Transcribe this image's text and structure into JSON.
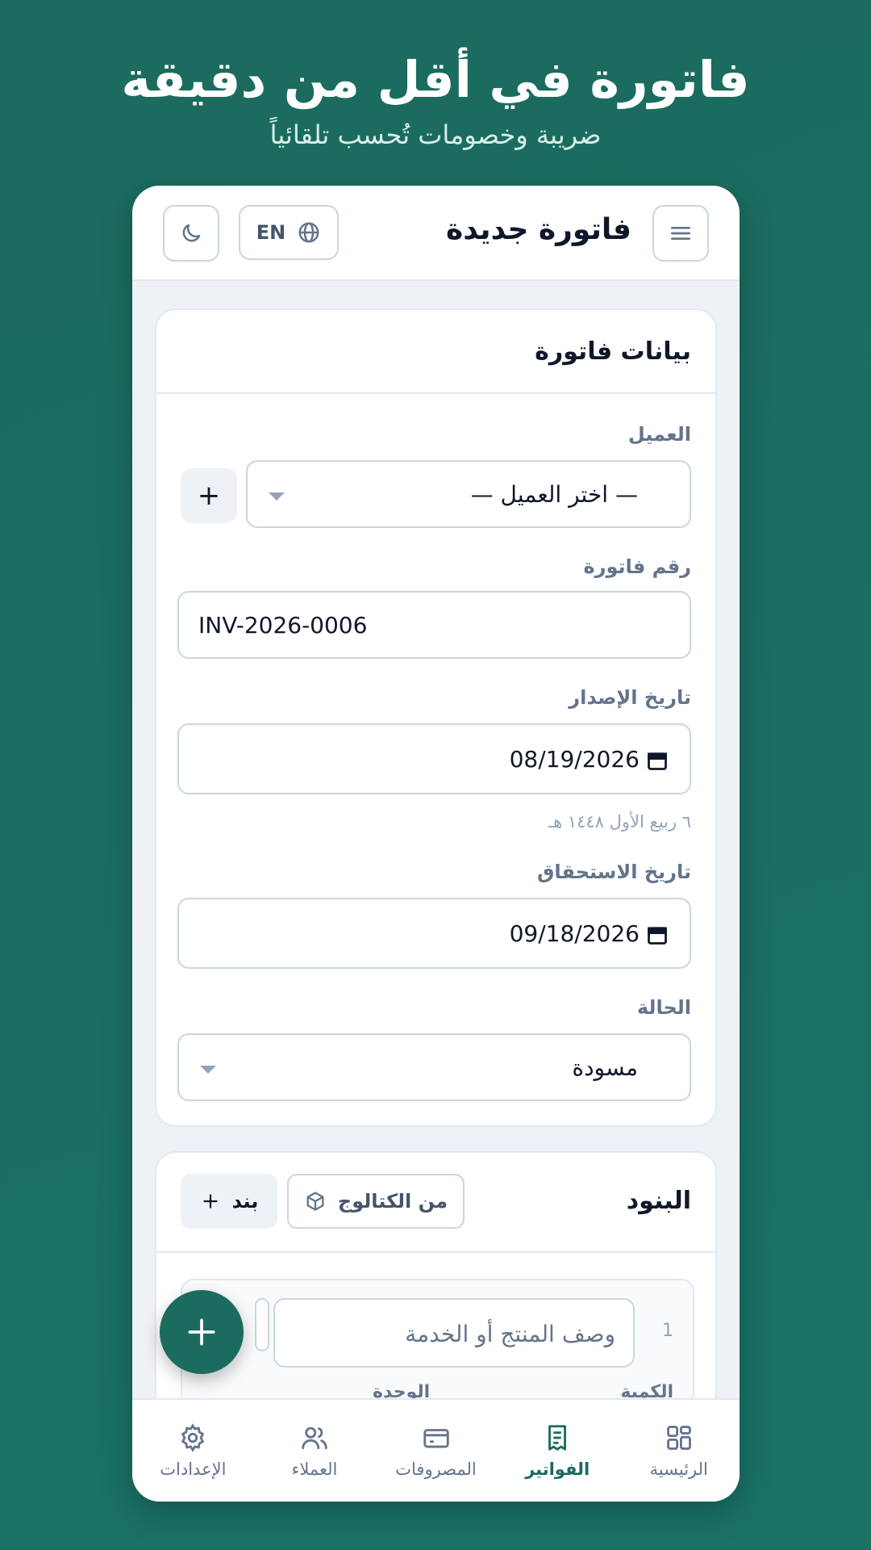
{
  "hero": {
    "title": "فاتورة في أقل من دقيقة",
    "subtitle": "ضريبة وخصومات تُحسب تلقائياً"
  },
  "header": {
    "title": "فاتورة جديدة",
    "lang_label": "EN",
    "icons": [
      "menu-icon",
      "globe-icon",
      "moon-icon"
    ]
  },
  "invoice_card": {
    "title": "بيانات فاتورة",
    "client_label": "العميل",
    "client_value": "— اختر العميل —",
    "add_client": "+",
    "number_label": "رقم فاتورة",
    "number_value": "INV-2026-0006",
    "issue_date_label": "تاريخ الإصدار",
    "issue_date_value": "08/19/2026",
    "issue_date_hijri": "٦ ربيع الأول ١٤٤٨ هـ",
    "due_date_label": "تاريخ الاستحقاق",
    "due_date_value": "09/18/2026",
    "status_label": "الحالة",
    "status_value": "مسودة"
  },
  "items_card": {
    "title": "البنود",
    "catalog_button": "من الكتالوج",
    "add_item_button": "بند",
    "item_index": "1",
    "item_placeholder": "وصف المنتج أو الخدمة",
    "qty_label": "الكمية",
    "unit_label": "الوحدة"
  },
  "bottom_nav": {
    "active": "invoices",
    "items": [
      {
        "id": "home",
        "label": "الرئيسية",
        "icon": "dashboard-icon"
      },
      {
        "id": "invoices",
        "label": "الفواتير",
        "icon": "receipt-icon"
      },
      {
        "id": "expenses",
        "label": "المصروفات",
        "icon": "credit-card-icon"
      },
      {
        "id": "clients",
        "label": "العملاء",
        "icon": "users-icon"
      },
      {
        "id": "settings",
        "label": "الإعدادات",
        "icon": "gear-icon"
      }
    ]
  },
  "colors": {
    "brand": "#1b6b5e",
    "text": "#0f172a",
    "muted": "#64748b",
    "border": "#cbd5e1"
  }
}
